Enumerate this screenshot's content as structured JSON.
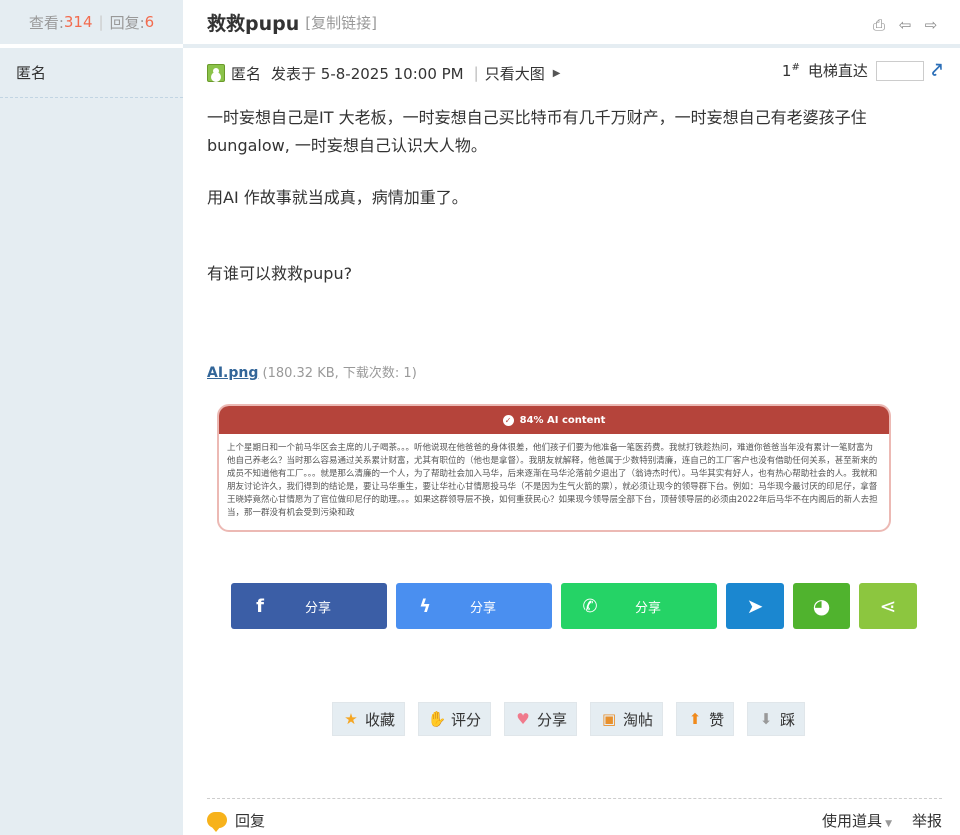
{
  "stats": {
    "views_label": "查看:",
    "views": "314",
    "replies_label": "回复:",
    "replies": "6"
  },
  "author": {
    "name": "匿名"
  },
  "thread": {
    "title": "救救pupu",
    "copy_link": "[复制链接]"
  },
  "meta": {
    "name": "匿名",
    "posted": "发表于 5-8-2025 10:00 PM",
    "only_author": "只看大图",
    "floor": "1",
    "floor_sup": "#",
    "elevator": "电梯直达"
  },
  "content": {
    "p1": "一时妄想自己是IT 大老板，一时妄想自己买比特币有几千万财产，一时妄想自己有老婆孩子住bungalow, 一时妄想自己认识大人物。",
    "p2": "用AI 作故事就当成真，病情加重了。",
    "p3": "有谁可以救救pupu?"
  },
  "attachment": {
    "filename": "AI.png",
    "info": "(180.32 KB, 下载次数: 1)"
  },
  "ai_image": {
    "header": "84% AI content",
    "text": "上个星期日和一个前马华区会主席的儿子喝茶。。。听他说现在他爸爸的身体很差，他们孩子们要为他准备一笔医药费。我就打铁趁热问，难道你爸爸当年没有累计一笔财富为他自己养老么？当时那么容易通过关系累计财富，尤其有职位的（他也是拿督）。我朋友就解释，他爸属于少数特别清廉，连自己的工厂客户也没有借助任何关系，甚至新来的成员不知道他有工厂。。。就是那么清廉的一个人，为了帮助社会加入马华，后来逐渐在马华沦落前夕退出了（翁诗杰时代）。马华其实有好人，也有热心帮助社会的人。我就和朋友讨论许久，我们得到的结论是，要让马华重生，要让华社心甘情愿投马华（不是因为生气火箭的票），就必须让现今的领导群下台。例如：马华现今最讨厌的印尼仔，拿督王晓婷竟然心甘情愿为了官位做印尼仔的助理。。。如果这群领导层不换，如何重获民心？如果现今领导层全部下台，顶替领导层的必须由2022年后马华不在内阁后的新人去担当，那一群没有机会受到污染和政"
  },
  "share": {
    "facebook": "分享",
    "messenger": "分享",
    "whatsapp": "分享"
  },
  "actions": {
    "favorite": "收藏",
    "rate": "评分",
    "share": "分享",
    "taotie": "淘帖",
    "like": "赞",
    "dislike": "踩"
  },
  "footer": {
    "reply": "回复",
    "tools": "使用道具",
    "report": "举报"
  },
  "colors": {
    "accent": "#f26c4f",
    "sidebar": "#e5edf2",
    "ai_red": "#b5443b"
  }
}
